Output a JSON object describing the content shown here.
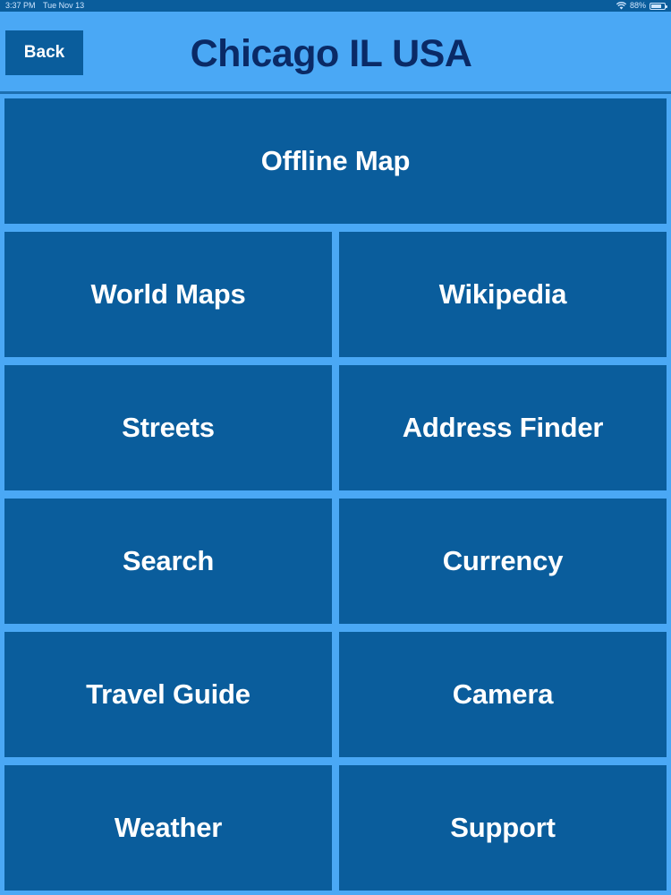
{
  "status_bar": {
    "time": "3:37 PM",
    "date": "Tue Nov 13",
    "battery": "88%"
  },
  "header": {
    "back_label": "Back",
    "title": "Chicago IL USA"
  },
  "menu": {
    "offline_map": "Offline Map",
    "world_maps": "World Maps",
    "wikipedia": "Wikipedia",
    "streets": "Streets",
    "address_finder": "Address Finder",
    "search": "Search",
    "currency": "Currency",
    "travel_guide": "Travel Guide",
    "camera": "Camera",
    "weather": "Weather",
    "support": "Support"
  },
  "colors": {
    "background": "#4aa8f5",
    "tile": "#0a5d9c",
    "title": "#0a2a66",
    "tile_text": "#ffffff"
  }
}
